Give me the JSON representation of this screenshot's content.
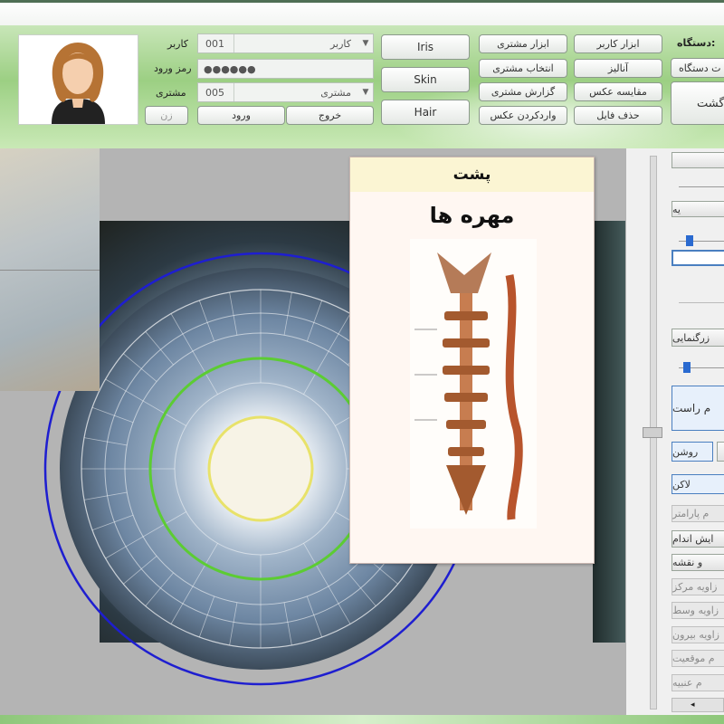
{
  "header": {
    "user_label": "کاربر",
    "user_code": "001",
    "user_value": "کاربر",
    "password_label": "رمز ورود",
    "password_value": "●●●●●●",
    "customer_label": "مشتری",
    "customer_code": "005",
    "customer_value": "مشتری",
    "gender_button": "زن",
    "login_button": "ورود",
    "exit_button": "خروج",
    "mode_buttons": [
      "Iris",
      "Skin",
      "Hair"
    ],
    "mid_buttons": [
      "ابزار مشتری",
      "انتخاب مشتری",
      "گزارش مشتری",
      "واردکردن عکس"
    ],
    "right_buttons": [
      "ابزار کاربر",
      "آنالیز",
      "مقایسه عکس",
      "حذف فایل"
    ],
    "device_label": ":دستگاه",
    "device_button": "ت دستگاه",
    "back_button": "گشت"
  },
  "popup": {
    "title": "پشت",
    "subtitle": "مهره ها"
  },
  "sidebar": {
    "btn_top": "یه",
    "btn_magnify": "زرگنمایی",
    "btn_right_eye": "م راست",
    "btn_bright": "روشن",
    "btn_lacuna": "لاکن",
    "btn_params": "م پارامتر",
    "btn_organs": "ایش اندام",
    "btn_map": "و نقشه",
    "btn_angle_center": "زاویه مرکز",
    "btn_angle_mid": "زاویه وسط",
    "btn_angle_out": "زاویه بیرون",
    "btn_position": "م موقعیت",
    "btn_lens": "م عنبیه"
  },
  "colors": {
    "header_green": "#9ccf83",
    "iris_outer_ring": "#1e1ed0",
    "iris_mid_ring": "#5ccc33",
    "pupil_ring": "#e8e26a"
  },
  "sliders": {
    "slider1_value": 0.2,
    "slider2_value": 0.15
  }
}
